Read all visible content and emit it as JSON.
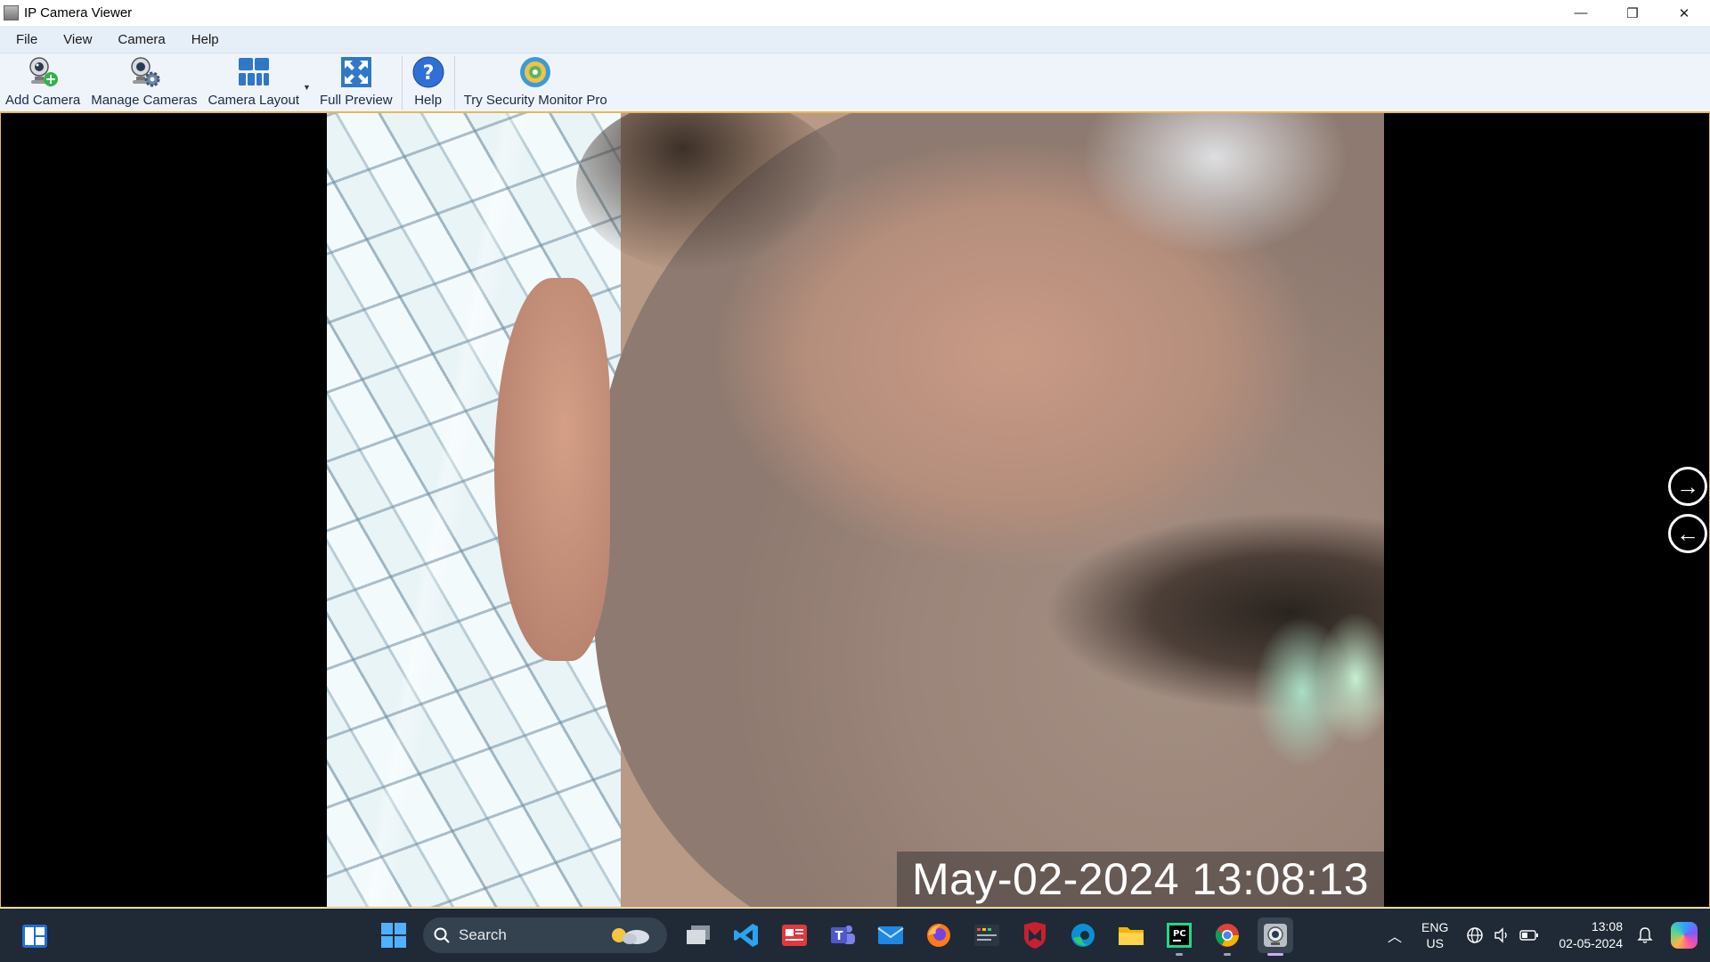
{
  "window": {
    "title": "IP Camera Viewer",
    "controls": {
      "minimize": "—",
      "restore": "❐",
      "close": "✕"
    }
  },
  "menu": {
    "items": [
      "File",
      "View",
      "Camera",
      "Help"
    ]
  },
  "toolbar": {
    "add_camera": "Add Camera",
    "manage_cameras": "Manage Cameras",
    "camera_layout": "Camera Layout",
    "full_preview": "Full Preview",
    "help": "Help",
    "try_pro": "Try Security Monitor Pro"
  },
  "viewer": {
    "timestamp": "May-02-2024 13:08:13",
    "next_arrow": "→",
    "prev_arrow": "←",
    "colors": {
      "frame_border": "#e5b85b",
      "background": "#000000"
    }
  },
  "taskbar": {
    "search_label": "Search",
    "apps": [
      "task-view",
      "vscode",
      "news",
      "teams",
      "mail",
      "firefox",
      "terminal",
      "mcafee",
      "edge",
      "file-explorer",
      "pycharm",
      "chrome",
      "ip-camera-viewer"
    ],
    "language_line1": "ENG",
    "language_line2": "US",
    "time": "13:08",
    "date": "02-05-2024",
    "background_color": "#1f2a36"
  }
}
